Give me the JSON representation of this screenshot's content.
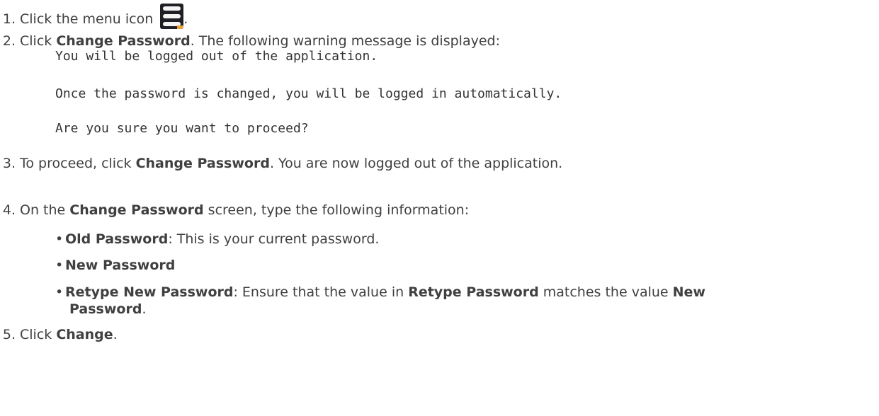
{
  "steps": [
    {
      "number": "1.",
      "text_before": "Click the menu icon",
      "icon": "menu-icon",
      "text_after": "."
    },
    {
      "number": "2.",
      "text_before": "Click ",
      "bold": "Change Password",
      "text_after": ". The following warning message is displayed:",
      "message_lines": [
        "You will be logged out of the application.",
        "Once the password is changed, you will be logged in automatically.",
        "Are you sure you want to proceed?"
      ]
    },
    {
      "number": "3.",
      "text_before": "To proceed, click ",
      "bold": "Change Password",
      "text_after": ". You are now logged out of the application."
    },
    {
      "number": "4.",
      "text_before": "On the ",
      "bold": "Change Password",
      "text_after": " screen, type the following information:",
      "bullets": [
        {
          "bold": "Old Password",
          "text": ": This is your current password."
        },
        {
          "bold": "New Password",
          "text": ""
        },
        {
          "bold": "Retype New Password",
          "text_a": ": Ensure that the value in ",
          "bold_b": "Retype Password",
          "text_c": " matches the value ",
          "bold_d": "New",
          "bold_e": "Password",
          "text_f": "."
        }
      ]
    },
    {
      "number": "5.",
      "text_before": "Click ",
      "bold": "Change",
      "text_after": "."
    }
  ],
  "colors": {
    "text": "#404040",
    "icon_bg": "#1f1f24",
    "icon_accent": "#e9a23b"
  }
}
